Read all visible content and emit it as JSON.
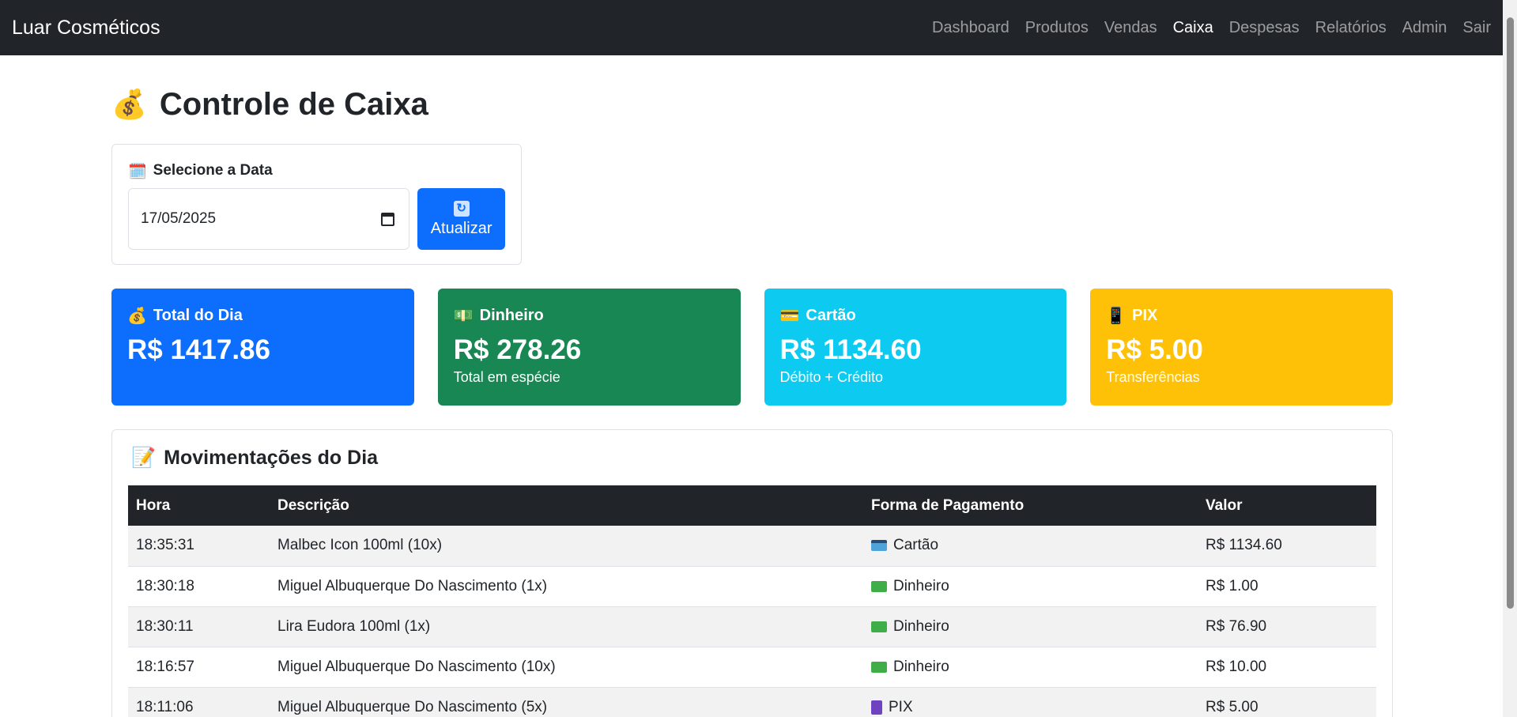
{
  "nav": {
    "brand": "Luar Cosméticos",
    "links": [
      "Dashboard",
      "Produtos",
      "Vendas",
      "Caixa",
      "Despesas",
      "Relatórios",
      "Admin",
      "Sair"
    ],
    "active": "Caixa"
  },
  "page": {
    "title_icon": "💰",
    "title": "Controle de Caixa"
  },
  "date_select": {
    "icon": "🗓️",
    "label": "Selecione a Data",
    "value": "17/05/2025",
    "button_label": "Atualizar"
  },
  "cards": [
    {
      "icon": "💰",
      "title": "Total do Dia",
      "value": "R$ 1417.86",
      "subtitle": "",
      "color": "#0d6efd"
    },
    {
      "icon": "💵",
      "title": "Dinheiro",
      "value": "R$ 278.26",
      "subtitle": "Total em espécie",
      "color": "#198754"
    },
    {
      "icon": "💳",
      "title": "Cartão",
      "value": "R$ 1134.60",
      "subtitle": "Débito + Crédito",
      "color": "#0dcaf0"
    },
    {
      "icon": "📱",
      "title": "PIX",
      "value": "R$ 5.00",
      "subtitle": "Transferências",
      "color": "#ffc107"
    }
  ],
  "movements": {
    "icon": "📝",
    "title": "Movimentações do Dia",
    "columns": [
      "Hora",
      "Descrição",
      "Forma de Pagamento",
      "Valor"
    ],
    "rows": [
      {
        "hora": "18:35:31",
        "descricao": "Malbec Icon 100ml (10x)",
        "pagamento": "Cartão",
        "valor": "R$ 1134.60"
      },
      {
        "hora": "18:30:18",
        "descricao": "Miguel Albuquerque Do Nascimento (1x)",
        "pagamento": "Dinheiro",
        "valor": "R$ 1.00"
      },
      {
        "hora": "18:30:11",
        "descricao": "Lira Eudora 100ml (1x)",
        "pagamento": "Dinheiro",
        "valor": "R$ 76.90"
      },
      {
        "hora": "18:16:57",
        "descricao": "Miguel Albuquerque Do Nascimento (10x)",
        "pagamento": "Dinheiro",
        "valor": "R$ 10.00"
      },
      {
        "hora": "18:11:06",
        "descricao": "Miguel Albuquerque Do Nascimento (5x)",
        "pagamento": "PIX",
        "valor": "R$ 5.00"
      }
    ]
  }
}
